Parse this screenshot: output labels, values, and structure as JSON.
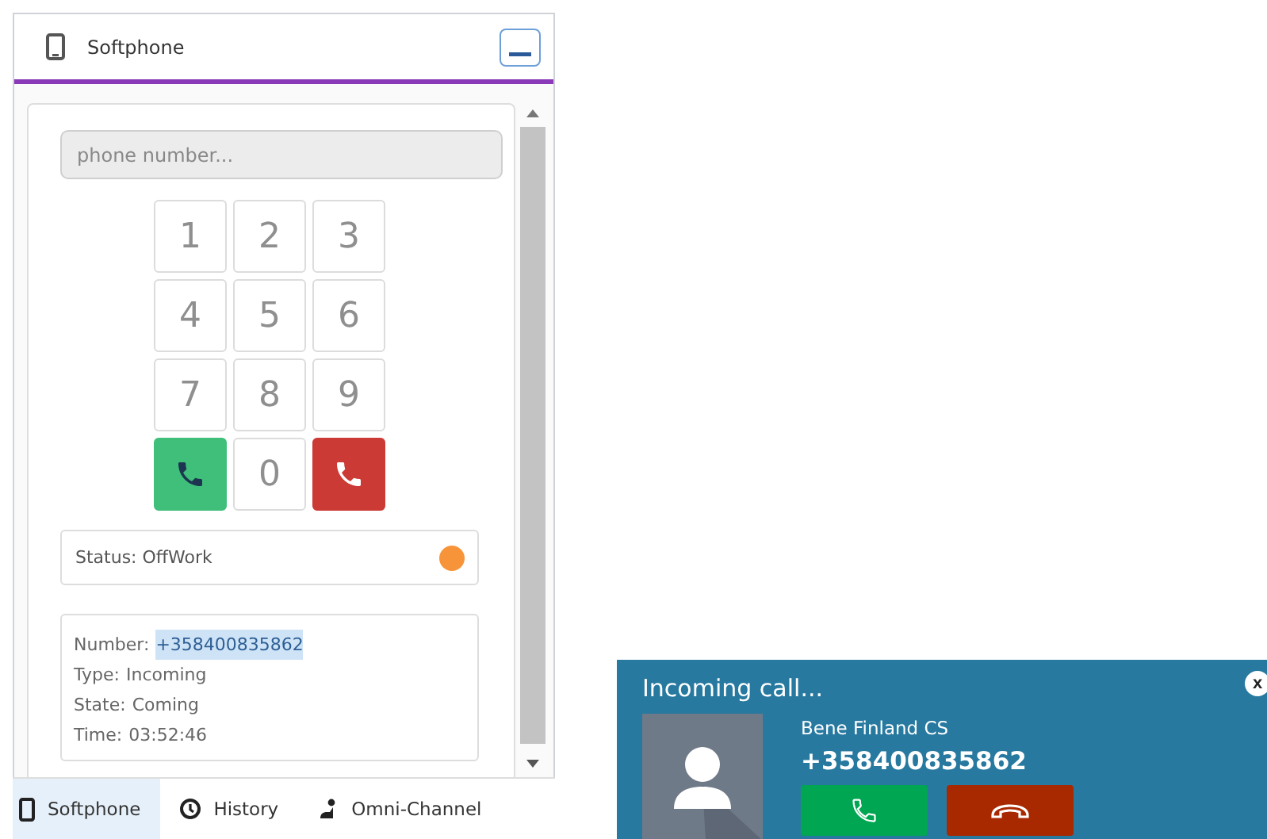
{
  "softphone": {
    "title": "Softphone",
    "phone_field": {
      "placeholder": "phone number..."
    },
    "keys": [
      {
        "kind": "digit",
        "label": "1"
      },
      {
        "kind": "digit",
        "label": "2"
      },
      {
        "kind": "digit",
        "label": "3"
      },
      {
        "kind": "digit",
        "label": "4"
      },
      {
        "kind": "digit",
        "label": "5"
      },
      {
        "kind": "digit",
        "label": "6"
      },
      {
        "kind": "digit",
        "label": "7"
      },
      {
        "kind": "digit",
        "label": "8"
      },
      {
        "kind": "digit",
        "label": "9"
      },
      {
        "kind": "call"
      },
      {
        "kind": "digit",
        "label": "0"
      },
      {
        "kind": "hangup"
      }
    ],
    "status": {
      "text": "Status: OffWork",
      "color": "#f7943a"
    },
    "call_info": [
      {
        "label": "Number:",
        "value": "+358400835862",
        "highlighted": true
      },
      {
        "label": "Type:",
        "value": "Incoming",
        "highlighted": false
      },
      {
        "label": "State:",
        "value": "Coming",
        "highlighted": false
      },
      {
        "label": "Time:",
        "value": "03:52:46",
        "highlighted": false
      }
    ]
  },
  "tabs": [
    {
      "kind": "phone",
      "label": "Softphone",
      "selected": true
    },
    {
      "kind": "clock",
      "label": "History",
      "selected": false
    },
    {
      "kind": "omni",
      "label": "Omni-Channel",
      "selected": false
    }
  ],
  "incoming_call": {
    "title": "Incoming call...",
    "caller_name": "Bene Finland CS",
    "caller_number": "+358400835862",
    "close": "x"
  }
}
